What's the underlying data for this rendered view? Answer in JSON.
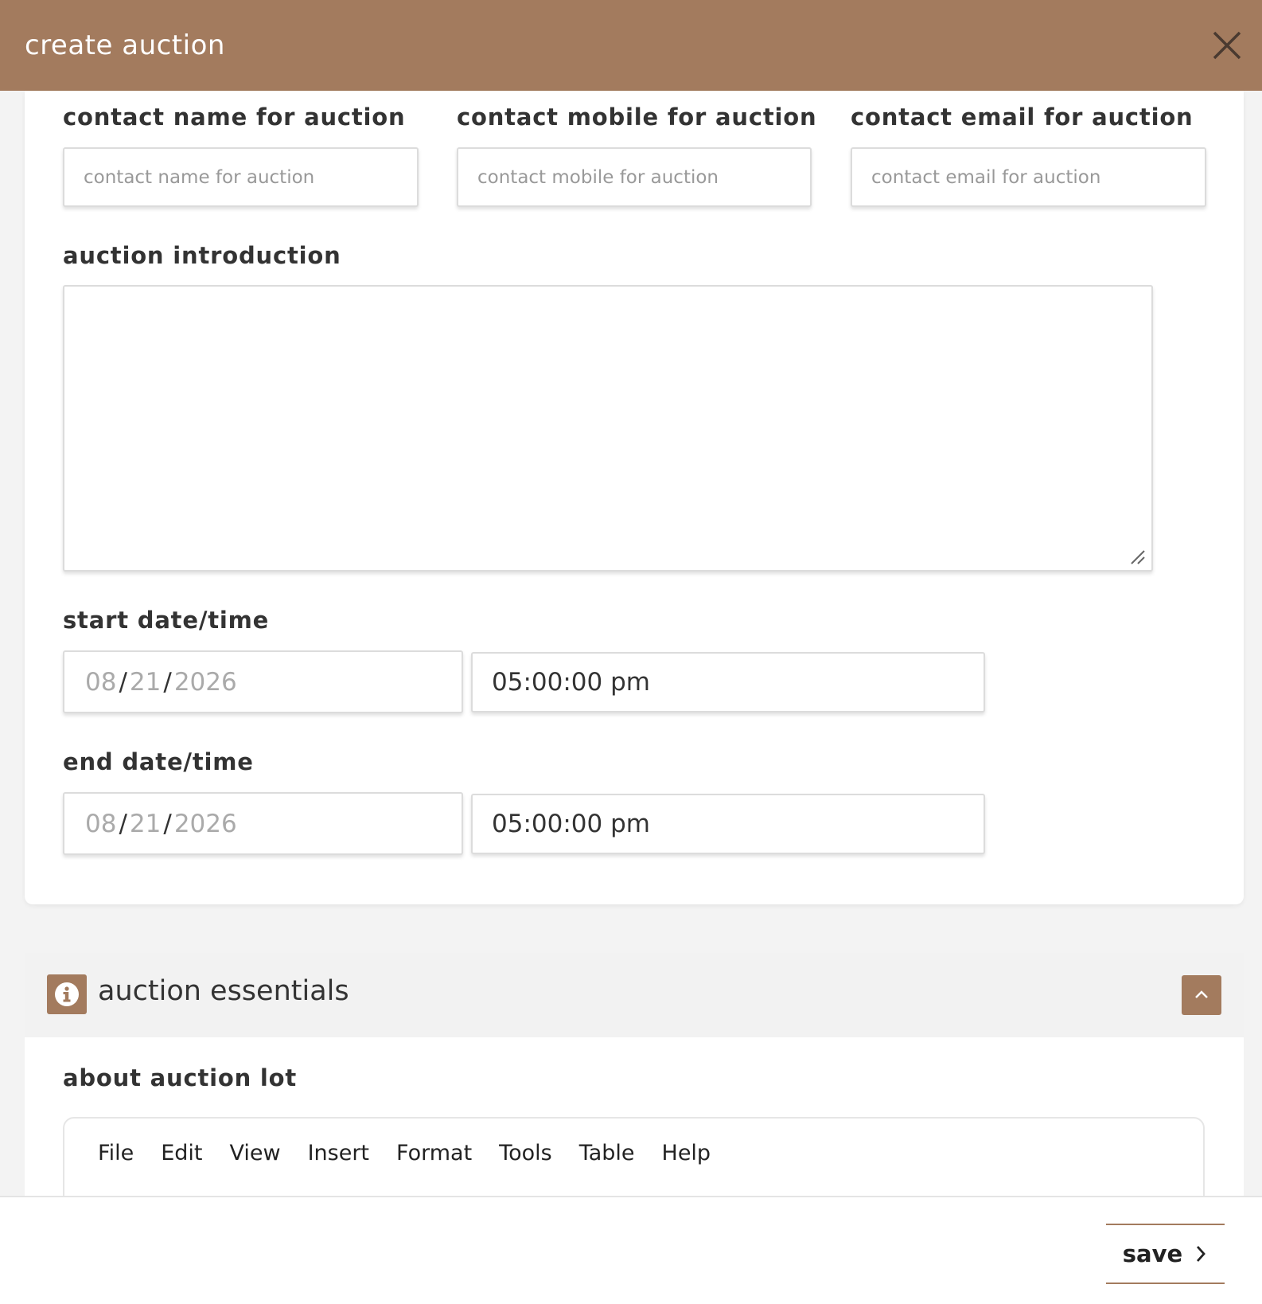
{
  "modal": {
    "title": "create auction"
  },
  "contact": {
    "name_label": "contact name for auction",
    "name_placeholder": "contact name for auction",
    "mobile_label": "contact mobile for auction",
    "mobile_placeholder": "contact mobile for auction",
    "email_label": "contact email for auction",
    "email_placeholder": "contact email for auction"
  },
  "introduction": {
    "label": "auction introduction",
    "value": ""
  },
  "start": {
    "label": "start date/time",
    "month": "08",
    "day": "21",
    "year": "2026",
    "time": "05:00:00 pm"
  },
  "end": {
    "label": "end date/time",
    "month": "08",
    "day": "21",
    "year": "2026",
    "time": "05:00:00 pm"
  },
  "essentials": {
    "title": "auction essentials",
    "about_label": "about auction lot",
    "menu": [
      "File",
      "Edit",
      "View",
      "Insert",
      "Format",
      "Tools",
      "Table",
      "Help"
    ]
  },
  "footer": {
    "save_label": "save"
  },
  "colors": {
    "accent": "#a37b5e"
  }
}
